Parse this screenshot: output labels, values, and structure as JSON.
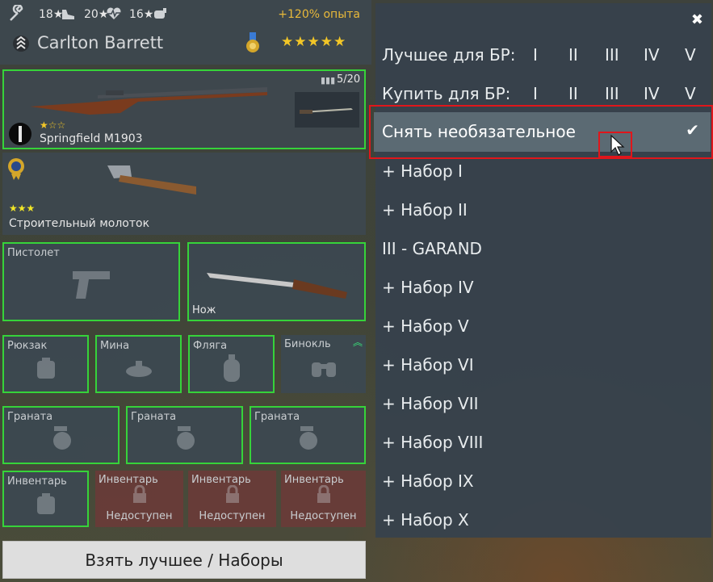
{
  "soldier": {
    "stats": [
      "18★",
      "20★",
      "16★"
    ],
    "xp_bonus": "+120% опыта",
    "name": "Carlton Barrett"
  },
  "primary_weapon": {
    "name": "Springfield M1903",
    "ammo": "5/20",
    "stars": "★☆☆"
  },
  "secondary_item": {
    "name": "Строительный молоток",
    "stars": "★★★"
  },
  "slots": {
    "pistol": "Пистолет",
    "knife": "Нож",
    "backpack": "Рюкзак",
    "mine": "Мина",
    "flask": "Фляга",
    "binoculars": "Бинокль",
    "grenades": [
      "Граната",
      "Граната",
      "Граната"
    ],
    "inventory": [
      "Инвентарь",
      "Инвентарь",
      "Инвентарь",
      "Инвентарь"
    ],
    "unavailable": "Недоступен"
  },
  "bottom_button": "Взять лучшее / Наборы",
  "menu": {
    "close": "✖",
    "best_for_br": "Лучшее для БР:",
    "buy_for_br": "Купить для БР:",
    "tiers": [
      "I",
      "II",
      "III",
      "IV",
      "V"
    ],
    "remove_optional": "Снять необязательное",
    "check": "✔",
    "kits": [
      "+ Набор I",
      "+ Набор II",
      "III - GARAND",
      "+ Набор IV",
      "+ Набор V",
      "+ Набор VI",
      "+ Набор VII",
      "+ Набор VIII",
      "+ Набор IX",
      "+ Набор X"
    ]
  },
  "colors": {
    "slot_border": "#36d33a",
    "bonus": "#e9b93a",
    "highlight_box": "#e0161b"
  }
}
